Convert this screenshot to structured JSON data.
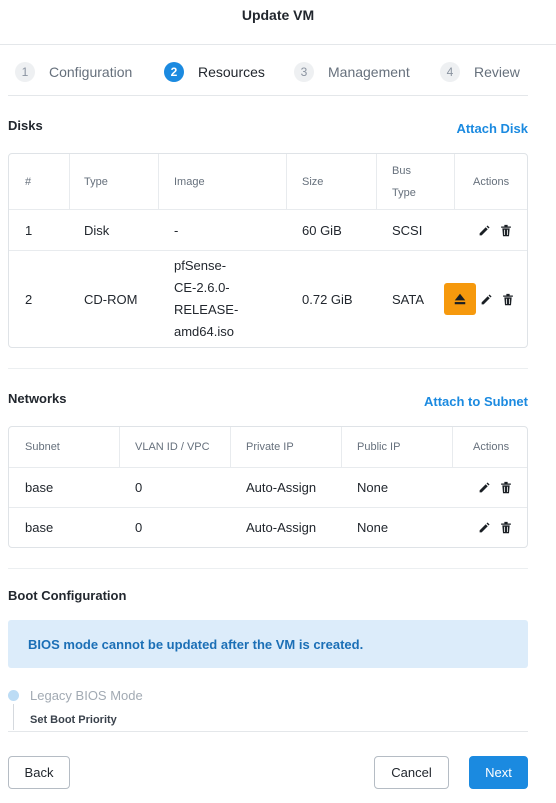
{
  "window": {
    "title": "Update VM"
  },
  "steps": [
    {
      "num": "1",
      "label": "Configuration"
    },
    {
      "num": "2",
      "label": "Resources"
    },
    {
      "num": "3",
      "label": "Management"
    },
    {
      "num": "4",
      "label": "Review"
    }
  ],
  "disks": {
    "title": "Disks",
    "attach_label": "Attach Disk",
    "headers": {
      "num": "#",
      "type": "Type",
      "image": "Image",
      "size": "Size",
      "bus_line1": "Bus",
      "bus_line2": "Type",
      "actions": "Actions"
    },
    "rows": [
      {
        "num": "1",
        "type": "Disk",
        "image": "-",
        "size": "60 GiB",
        "bus": "SCSI"
      },
      {
        "num": "2",
        "type": "CD-ROM",
        "image_lines": [
          "pfSense-",
          "CE-2.6.0-",
          "RELEASE-",
          "amd64.iso"
        ],
        "size": "0.72 GiB",
        "bus": "SATA"
      }
    ]
  },
  "networks": {
    "title": "Networks",
    "attach_label": "Attach to Subnet",
    "headers": {
      "subnet": "Subnet",
      "vlan": "VLAN ID / VPC",
      "private_ip": "Private IP",
      "public_ip": "Public IP",
      "actions": "Actions"
    },
    "rows": [
      {
        "subnet": "base",
        "vlan": "0",
        "private_ip": "Auto-Assign",
        "public_ip": "None"
      },
      {
        "subnet": "base",
        "vlan": "0",
        "private_ip": "Auto-Assign",
        "public_ip": "None"
      }
    ]
  },
  "boot": {
    "title": "Boot Configuration",
    "banner": "BIOS mode cannot be updated after the VM is created.",
    "mode_label": "Legacy BIOS Mode",
    "priority_label": "Set Boot Priority"
  },
  "footer": {
    "back": "Back",
    "cancel": "Cancel",
    "next": "Next"
  },
  "colors": {
    "accent": "#1b8ae0",
    "highlight": "#f6990d",
    "banner_bg": "#dcecfa"
  },
  "icons": {
    "edit": "pencil-icon",
    "delete": "trash-icon",
    "eject": "eject-icon"
  }
}
